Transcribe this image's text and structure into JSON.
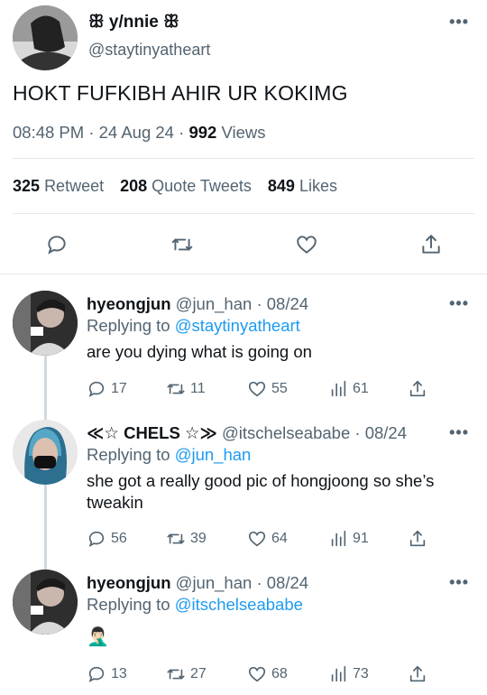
{
  "main": {
    "display_name": "ꕥ y/nnie ꕥ",
    "handle": "@staytinyatheart",
    "text": "HOKT FUFKIBH AHIR UR KOKIMG",
    "time": "08:48 PM",
    "date": "24 Aug 24",
    "views_count": "992",
    "views_label": "Views",
    "retweets_count": "325",
    "retweets_label": "Retweet",
    "quotes_count": "208",
    "quotes_label": "Quote Tweets",
    "likes_count": "849",
    "likes_label": "Likes",
    "more": "•••"
  },
  "replies": [
    {
      "name": "hyeongjun",
      "handle": "@jun_han",
      "date": "08/24",
      "replying_prefix": "Replying to",
      "replying_to": "@staytinyatheart",
      "text": "are you dying what is going on",
      "reply_count": "17",
      "retweet_count": "11",
      "like_count": "55",
      "view_count": "61",
      "more": "•••"
    },
    {
      "name": "≪☆ CHELS ☆≫",
      "handle": "@itschelseababe",
      "date": "08/24",
      "replying_prefix": "Replying to",
      "replying_to": "@jun_han",
      "text": "she got a really good pic of hongjoong so she’s tweakin",
      "reply_count": "56",
      "retweet_count": "39",
      "like_count": "64",
      "view_count": "91",
      "more": "•••"
    },
    {
      "name": "hyeongjun",
      "handle": "@jun_han",
      "date": "08/24",
      "replying_prefix": "Replying to",
      "replying_to": "@itschelseababe",
      "text": "🤦🏻‍♂️",
      "reply_count": "13",
      "retweet_count": "27",
      "like_count": "68",
      "view_count": "73",
      "more": "•••"
    }
  ],
  "colors": {
    "link": "#1d9bf0",
    "secondary_text": "#536471",
    "primary_text": "#0f1419",
    "divider": "#e4e8eb",
    "thread_line": "#cfd9de"
  },
  "icons": [
    "comment-icon",
    "retweet-icon",
    "like-icon",
    "share-icon",
    "views-icon",
    "more-icon"
  ]
}
